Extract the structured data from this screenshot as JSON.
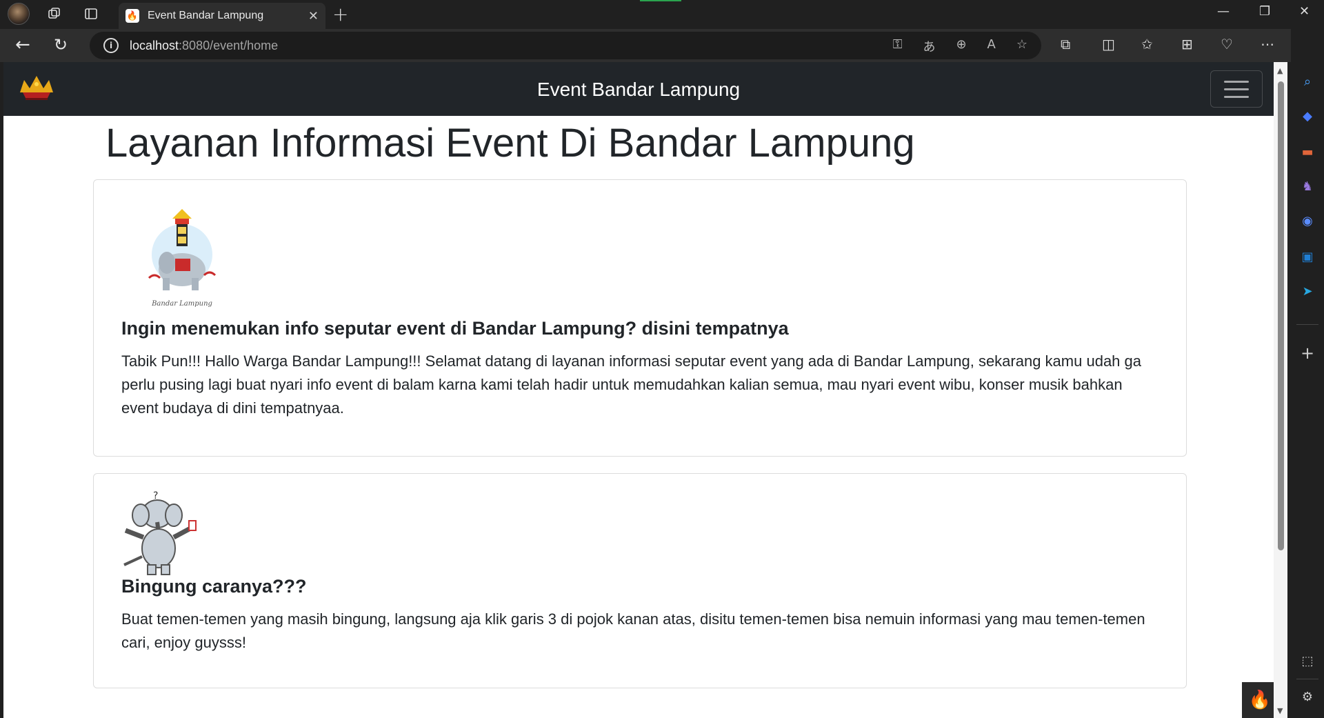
{
  "browser": {
    "tab_title": "Event Bandar Lampung",
    "tab_favicon": "fire-icon",
    "url_host": "localhost",
    "url_path": ":8080/event/home"
  },
  "site": {
    "nav_title": "Event Bandar Lampung",
    "heading": "Layanan Informasi Event Di Bandar Lampung",
    "logo_caption": "Bandar Lampung"
  },
  "cards": [
    {
      "title": "Ingin menemukan info seputar event di Bandar Lampung? disini tempatnya",
      "body": "Tabik Pun!!! Hallo Warga Bandar Lampung!!! Selamat datang di layanan informasi seputar event yang ada di Bandar Lampung, sekarang kamu udah ga perlu pusing lagi buat nyari info event di balam karna kami telah hadir untuk memudahkan kalian semua, mau nyari event wibu, konser musik bahkan event budaya di dini tempatnyaa."
    },
    {
      "title": "Bingung caranya???",
      "body": "Buat temen-temen yang masih bingung, langsung aja klik garis 3 di pojok kanan atas, disitu temen-temen bisa nemuin informasi yang mau temen-temen cari, enjoy guysss!"
    }
  ],
  "colors": {
    "navbar": "#212529",
    "accent_fire": "#ff5a1f"
  }
}
